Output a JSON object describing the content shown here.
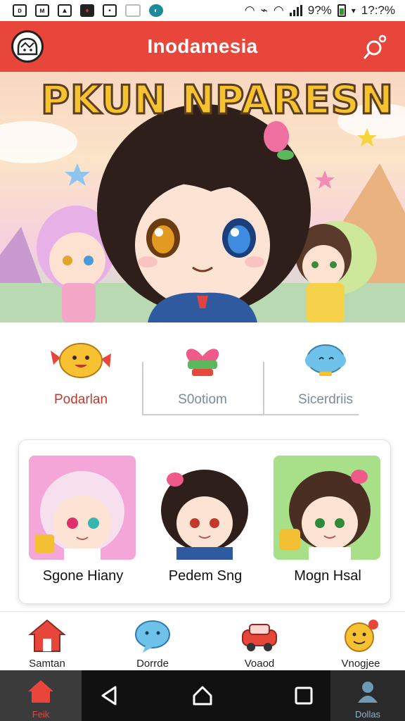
{
  "status_bar": {
    "left_icons": [
      "notification-a-icon",
      "notification-b-icon",
      "image-icon",
      "alert-icon",
      "checkbox-icon",
      "blank-icon",
      "app-icon"
    ],
    "battery_text": "9?%",
    "time": "1?:?%"
  },
  "app_bar": {
    "title": "Inodamesia",
    "logo_icon": "mascot-logo-icon",
    "search_icon": "search-icon"
  },
  "hero": {
    "title": "PKUN NPARESN"
  },
  "categories": [
    {
      "label": "Podarlan",
      "icon": "candy-face-icon",
      "color": "#c0392b"
    },
    {
      "label": "S0otiom",
      "icon": "heart-gift-icon",
      "color": "#7a8a9a"
    },
    {
      "label": "Sicerdriis",
      "icon": "cloud-face-icon",
      "color": "#7a8a9a"
    }
  ],
  "featured": [
    {
      "name": "Sgone Hiany",
      "bg": "#f4a6d8"
    },
    {
      "name": "Pedem Sng",
      "bg": "#ffffff"
    },
    {
      "name": "Mogn Hsal",
      "bg": "#a8e08a"
    }
  ],
  "bottom_nav": [
    {
      "label": "Samtan",
      "icon": "house-icon"
    },
    {
      "label": "Dorrde",
      "icon": "chat-bubble-icon"
    },
    {
      "label": "Voaod",
      "icon": "car-icon"
    },
    {
      "label": "Vnogjee",
      "icon": "smiley-badge-icon"
    }
  ],
  "system_nav": {
    "home_label": "Feik",
    "profile_label": "Dollas"
  },
  "colors": {
    "accent": "#e8453b",
    "text": "#222222"
  }
}
